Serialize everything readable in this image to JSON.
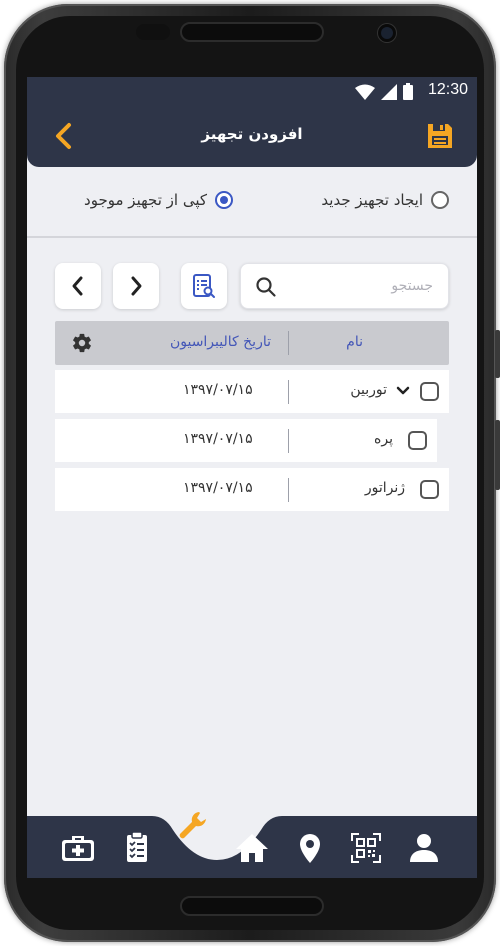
{
  "status": {
    "time": "12:30"
  },
  "appbar": {
    "title": "افزودن تجهیز"
  },
  "mode": {
    "new_label": "ایجاد تجهیز جدید",
    "copy_label": "کپی از تجهیز موجود",
    "selected": "copy"
  },
  "search": {
    "placeholder": "جستجو",
    "value": ""
  },
  "table": {
    "headers": {
      "name": "نام",
      "calibration_date": "تاریخ کالیبراسیون"
    },
    "rows": [
      {
        "name": "توربین",
        "date": "۱۳۹۷/۰۷/۱۵",
        "expandable": true,
        "checked": false
      },
      {
        "name": "پره",
        "date": "۱۳۹۷/۰۷/۱۵",
        "expandable": false,
        "checked": false
      },
      {
        "name": "ژنراتور",
        "date": "۱۳۹۷/۰۷/۱۵",
        "expandable": false,
        "checked": false
      }
    ]
  },
  "bottom_nav": {
    "items": [
      "first-aid-kit-icon",
      "clipboard-list-icon",
      "wrench-icon",
      "home-icon",
      "location-pin-icon",
      "qr-scan-icon",
      "user-icon"
    ],
    "active": "wrench-icon"
  },
  "colors": {
    "header_bg": "#2e3548",
    "accent_orange": "#f5a623",
    "accent_blue": "#3b58c4",
    "screen_bg": "#eeeff3"
  }
}
